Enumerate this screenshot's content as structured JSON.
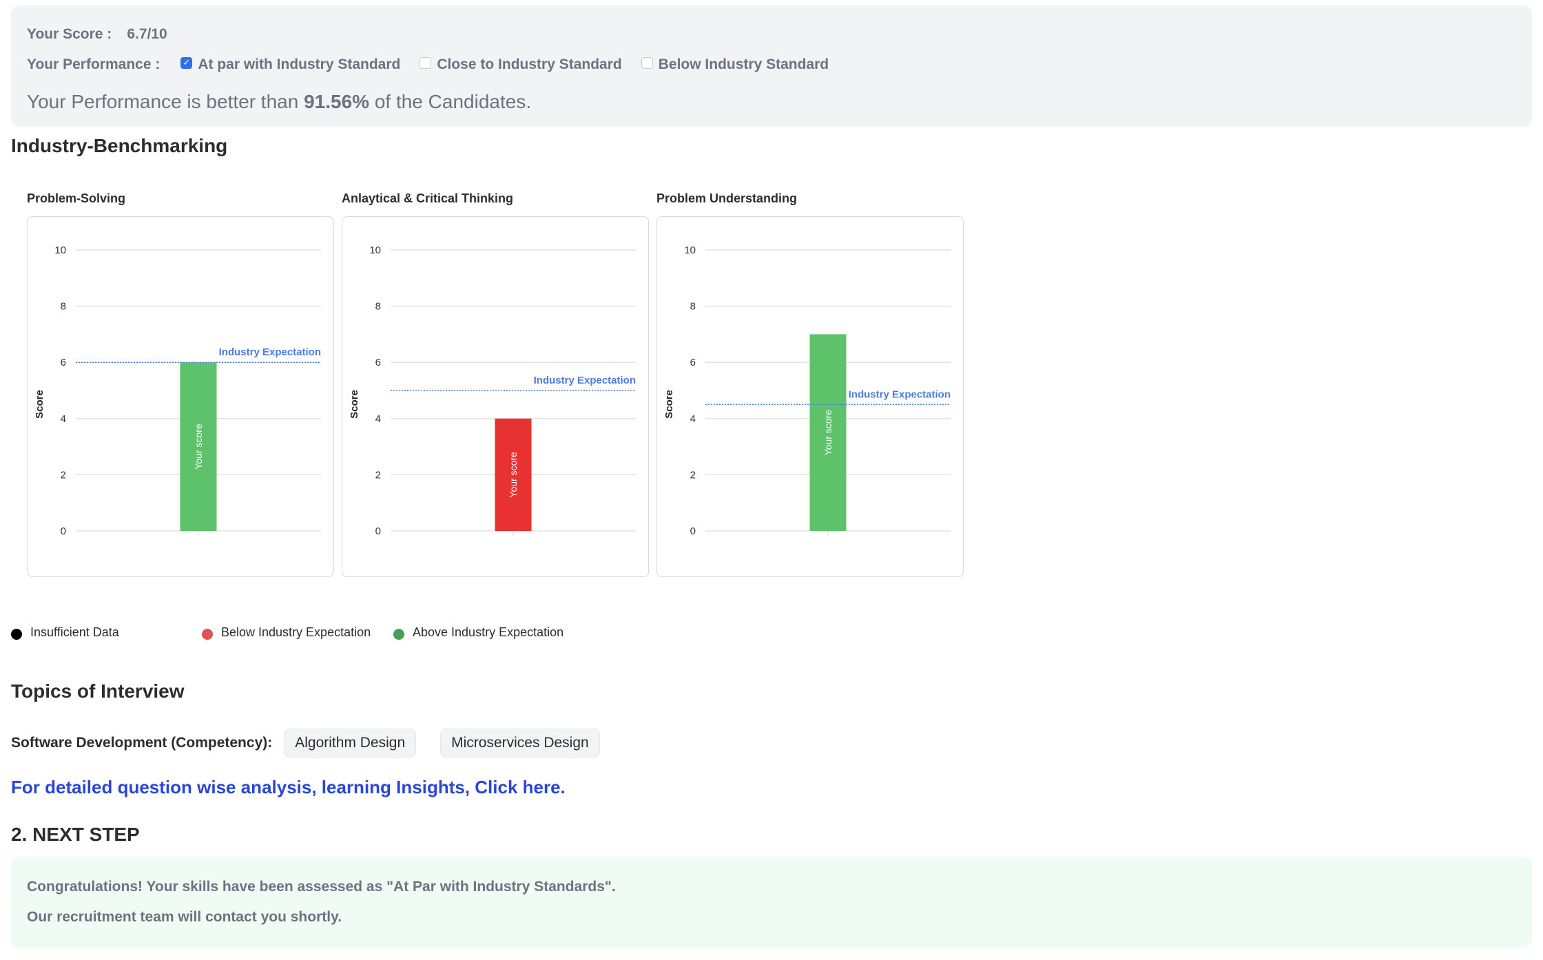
{
  "summary": {
    "score_label": "Your Score :",
    "score_value": "6.7/10",
    "performance_label": "Your Performance :",
    "performance_options": [
      {
        "label": "At par with Industry Standard",
        "checked": true
      },
      {
        "label": "Close to Industry Standard",
        "checked": false
      },
      {
        "label": "Below Industry Standard",
        "checked": false
      }
    ],
    "percentile_prefix": "Your Performance is better than ",
    "percentile_value": "91.56%",
    "percentile_suffix": " of the Candidates."
  },
  "benchmarking": {
    "heading": "Industry-Benchmarking"
  },
  "chart_data": [
    {
      "type": "bar",
      "title": "Problem-Solving",
      "categories": [
        ""
      ],
      "values": [
        6
      ],
      "bar_label": "Your score",
      "bar_color": "#5ec26a",
      "reference_line": {
        "label": "Industry Expectation",
        "value": 6,
        "color": "#4a7be0"
      },
      "ylabel": "Score",
      "xlabel": "",
      "ylim": [
        0,
        10
      ],
      "yticks": [
        0,
        2,
        4,
        6,
        8,
        10
      ],
      "grid": true
    },
    {
      "type": "bar",
      "title": "Anlaytical & Critical Thinking",
      "categories": [
        ""
      ],
      "values": [
        4
      ],
      "bar_label": "Your score",
      "bar_color": "#e83232",
      "reference_line": {
        "label": "Industry Expectation",
        "value": 5,
        "color": "#4a7be0"
      },
      "ylabel": "Score",
      "xlabel": "",
      "ylim": [
        0,
        10
      ],
      "yticks": [
        0,
        2,
        4,
        6,
        8,
        10
      ],
      "grid": true
    },
    {
      "type": "bar",
      "title": "Problem Understanding",
      "categories": [
        ""
      ],
      "values": [
        7
      ],
      "bar_label": "Your score",
      "bar_color": "#5ec26a",
      "reference_line": {
        "label": "Industry Expectation",
        "value": 4.5,
        "color": "#4a7be0"
      },
      "ylabel": "Score",
      "xlabel": "",
      "ylim": [
        0,
        10
      ],
      "yticks": [
        0,
        2,
        4,
        6,
        8,
        10
      ],
      "grid": true
    }
  ],
  "legend": [
    {
      "label": "Insufficient Data",
      "color": "#000000"
    },
    {
      "label": "Below Industry Expectation",
      "color": "#e05252"
    },
    {
      "label": "Above Industry Expectation",
      "color": "#4a9e55"
    }
  ],
  "topics": {
    "heading": "Topics of Interview",
    "competency_label": "Software Development (Competency):",
    "chips": [
      "Algorithm Design",
      "Microservices Design"
    ]
  },
  "detail_link": "For detailed question wise analysis, learning Insights, Click here.",
  "next_step": {
    "heading": "2. NEXT STEP",
    "lines": [
      "Congratulations! Your skills have been assessed as \"At Par with Industry Standards\".",
      "Our recruitment team will contact you shortly."
    ]
  }
}
